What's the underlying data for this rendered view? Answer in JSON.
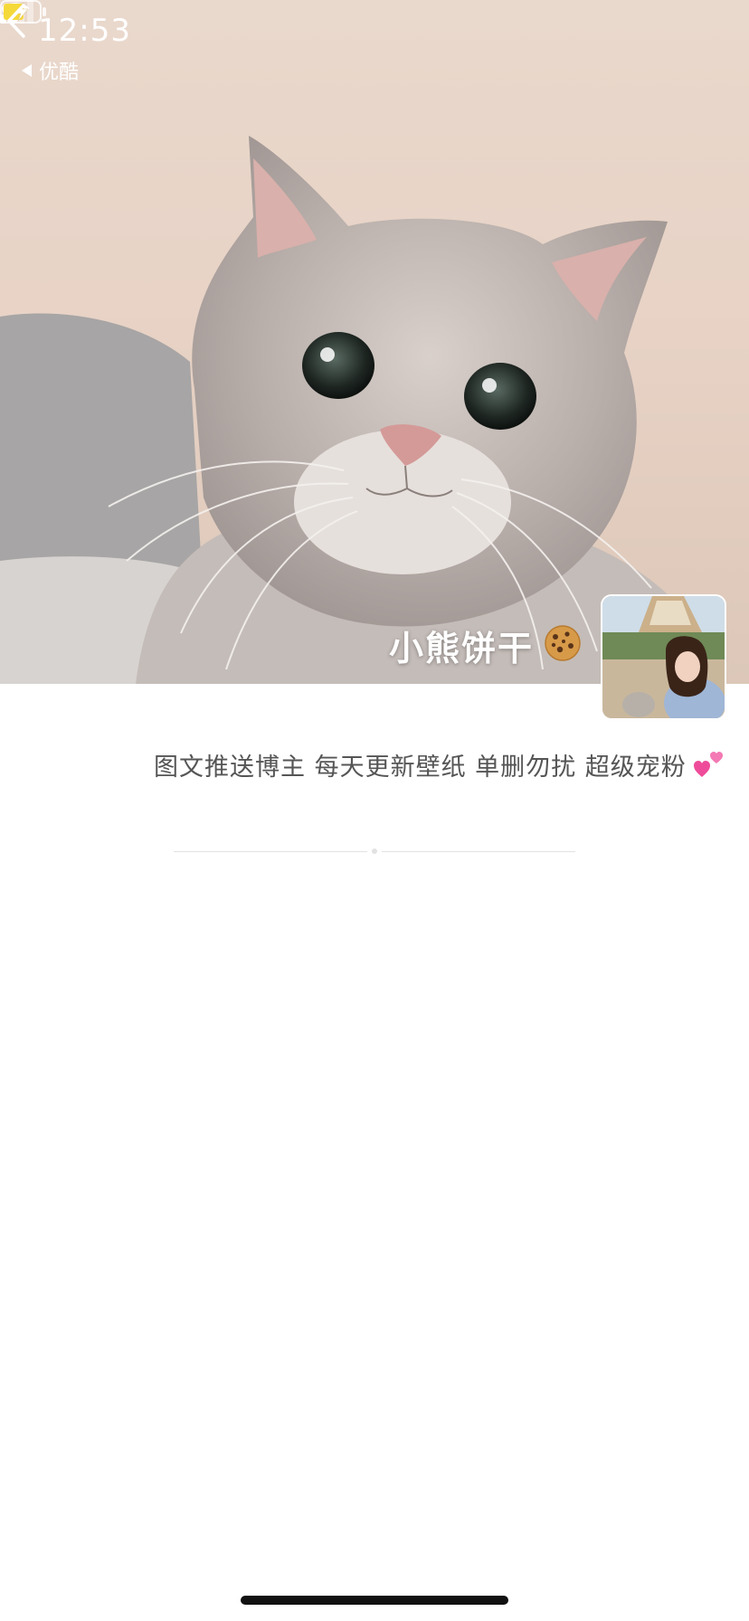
{
  "status_bar": {
    "time": "12:53",
    "back_app_label": "优酷",
    "icons": [
      "heart-icon",
      "signal-icon",
      "wifi-icon",
      "battery-charging-icon"
    ]
  },
  "nav": {
    "back_icon": "chevron-left-icon"
  },
  "profile": {
    "name": "小熊饼干",
    "name_emoji": "cookie-icon",
    "bio": "图文推送博主 每天更新壁纸 单删勿扰 超级宠粉",
    "bio_emoji": "two-hearts-icon"
  },
  "colors": {
    "background": "#ffffff",
    "bio_text": "#555555",
    "battery_fill": "#f5d93a",
    "divider": "#e2e2e2"
  }
}
